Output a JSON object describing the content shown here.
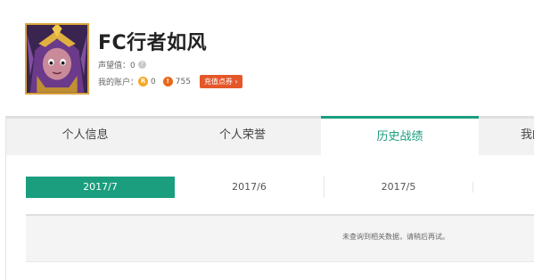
{
  "profile": {
    "name": "FC行者如风",
    "prestige_text": "声望值：0",
    "account_label": "我的账户：",
    "coin_r_value": "0",
    "coin_i_value": "755",
    "recharge_label": "充值点券 ›"
  },
  "tabs": [
    {
      "label": "个人信息"
    },
    {
      "label": "个人荣誉"
    },
    {
      "label": "历史战绩"
    },
    {
      "label": "我的"
    }
  ],
  "months": [
    {
      "label": "2017/7"
    },
    {
      "label": "2017/6"
    },
    {
      "label": "2017/5"
    }
  ],
  "result": {
    "empty_message": "未查询到相关数据，请稍后再试。"
  },
  "colors": {
    "accent": "#1a9e7e",
    "recharge": "#e4572a",
    "coin_r": "#f5a623",
    "coin_i": "#e8671c"
  }
}
